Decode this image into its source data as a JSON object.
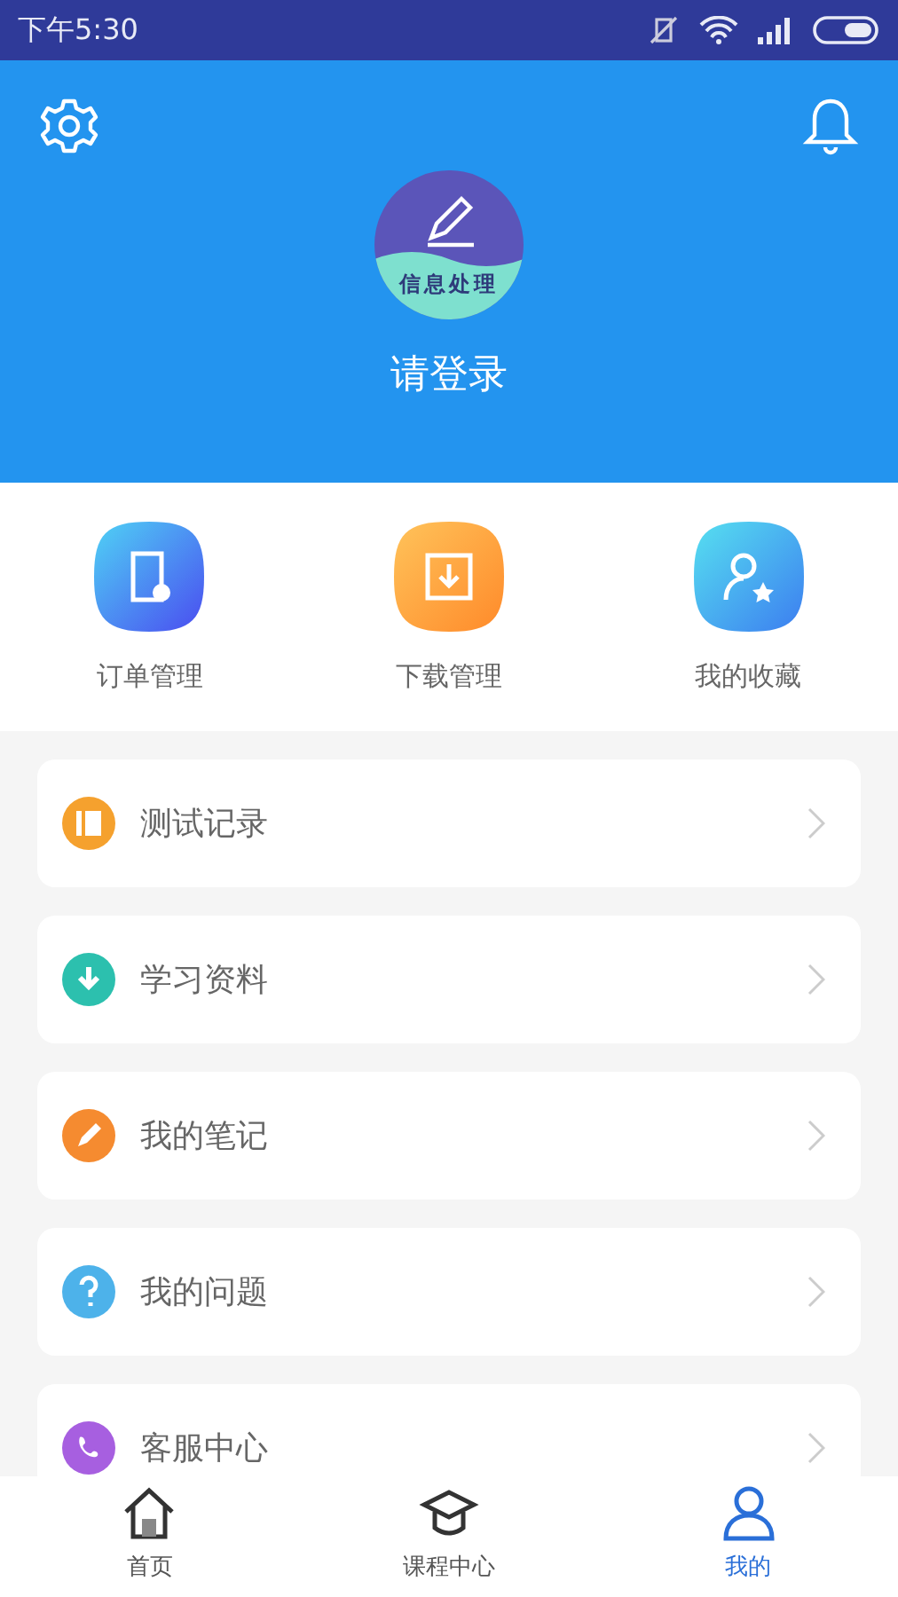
{
  "status_bar": {
    "time": "下午5:30"
  },
  "header": {
    "avatar_caption": "信息处理",
    "login": "请登录"
  },
  "quick_actions": [
    {
      "label": "订单管理"
    },
    {
      "label": "下载管理"
    },
    {
      "label": "我的收藏"
    }
  ],
  "menu": [
    {
      "label": "测试记录",
      "color": "#f5a12e"
    },
    {
      "label": "学习资料",
      "color": "#2cc0ae"
    },
    {
      "label": "我的笔记",
      "color": "#f58b30"
    },
    {
      "label": "我的问题",
      "color": "#4db2ea"
    },
    {
      "label": "客服中心",
      "color": "#a75fe0"
    }
  ],
  "tab_bar": [
    {
      "label": "首页",
      "selected": false
    },
    {
      "label": "课程中心",
      "selected": false
    },
    {
      "label": "我的",
      "selected": true
    }
  ]
}
